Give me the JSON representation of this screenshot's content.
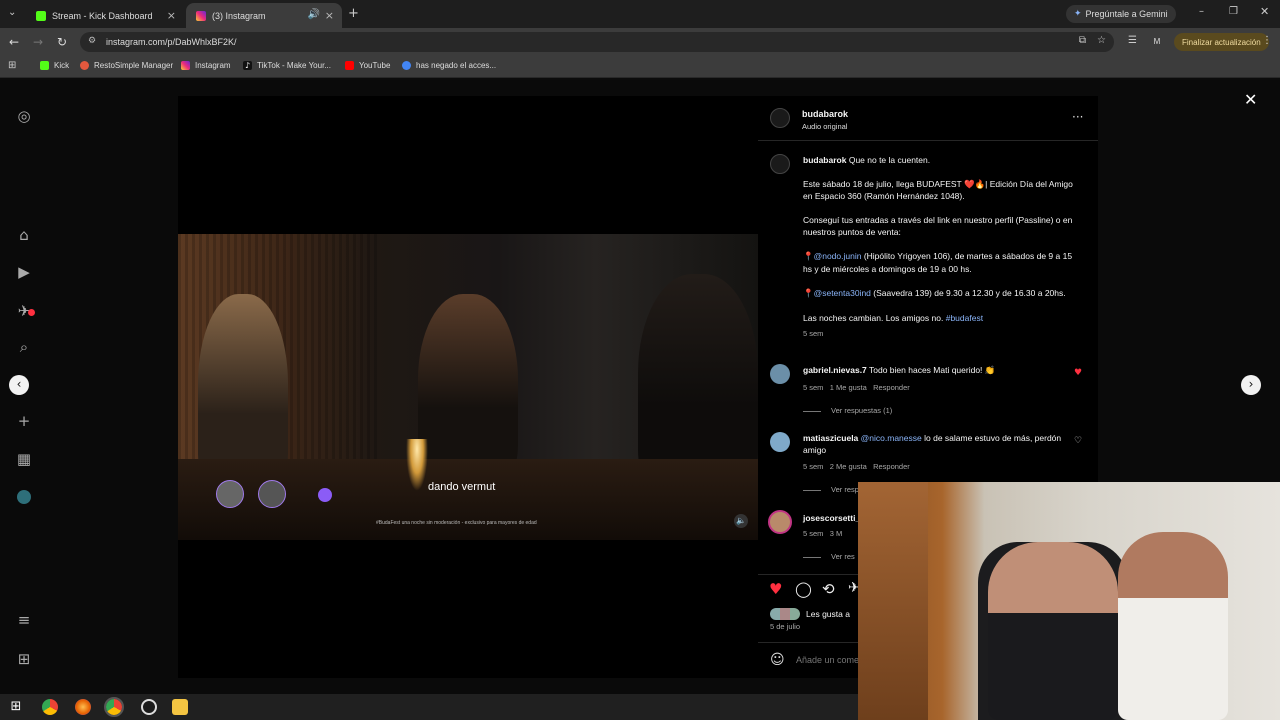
{
  "browser": {
    "tabs": [
      {
        "title": "Stream - Kick Dashboard",
        "favicon": "kick-icon",
        "color": "#53fc18"
      },
      {
        "title": "(3) Instagram",
        "favicon": "instagram-icon",
        "color": "#e1306c"
      }
    ],
    "gemini_button": "Pregúntale a Gemini",
    "url": "instagram.com/p/DabWhlxBF2K/",
    "profile_letter": "M",
    "update_button": "Finalizar actualización",
    "bookmarks": [
      {
        "label": "Kick",
        "icon": "kick-icon",
        "color": "#53fc18"
      },
      {
        "label": "RestoSimple Manager",
        "icon": "restosimple-icon",
        "color": "#e2583e"
      },
      {
        "label": "Instagram",
        "icon": "instagram-icon",
        "color": "#e1306c"
      },
      {
        "label": "TikTok - Make Your...",
        "icon": "tiktok-icon",
        "color": "#111111"
      },
      {
        "label": "YouTube",
        "icon": "youtube-icon",
        "color": "#ff0000"
      },
      {
        "label": "has negado el acces...",
        "icon": "google-icon",
        "color": "#4285f4"
      }
    ]
  },
  "post": {
    "author": "budabarok",
    "audio": "Audio original",
    "caption_intro": "Que no te la cuenten.",
    "caption_p1": "Este sábado 18 de julio, llega BUDAFEST ❤️🔥| Edición Día del Amigo en Espacio 360 (Ramón Hernández 1048).",
    "caption_p2": "Conseguí tus entradas a través del link en nuestro perfil (Passline) o en nuestros puntos de venta:",
    "point1_handle": "@nodo.junin",
    "point1_text": "(Hipólito Yrigoyen 106), de martes a sábados de 9 a 15 hs y de miércoles a domingos de 19 a 00 hs.",
    "point2_handle": "@setenta30ind",
    "point2_text": "(Saavedra 139) de 9.30 a 12.30 y de 16.30 a 20hs.",
    "caption_p5": "Las noches cambian. Los amigos no.",
    "hashtag": "#budafest",
    "caption_time": "5 sem",
    "video_overlay_text": "dando vermut",
    "video_disclaimer": "#BudaFest una noche sin moderación - exclusivo para mayores de edad",
    "likes_text": "Les gusta a",
    "date": "5 de julio",
    "add_comment_placeholder": "Añade un come"
  },
  "comments": [
    {
      "user": "gabriel.nievas.7",
      "text": "Todo bien haces Mati querido! 👏",
      "time": "5 sem",
      "likes": "1 Me gusta",
      "reply": "Responder",
      "view_replies": "Ver respuestas (1)",
      "liked": true
    },
    {
      "user": "matiaszicuela",
      "mention": "@nico.manesse",
      "text": "lo de salame estuvo de más, perdón amigo",
      "time": "5 sem",
      "likes": "2 Me gusta",
      "reply": "Responder",
      "view_replies": "Ver resp",
      "liked": false
    },
    {
      "user": "josescorsetti_",
      "time": "5 sem",
      "likes": "3 M",
      "view_replies": "Ver res"
    }
  ],
  "taskbar": {
    "apps": [
      "windows-icon",
      "chrome-icon",
      "firefox-icon",
      "chrome-profile-icon",
      "obs-icon",
      "folder-icon"
    ]
  }
}
